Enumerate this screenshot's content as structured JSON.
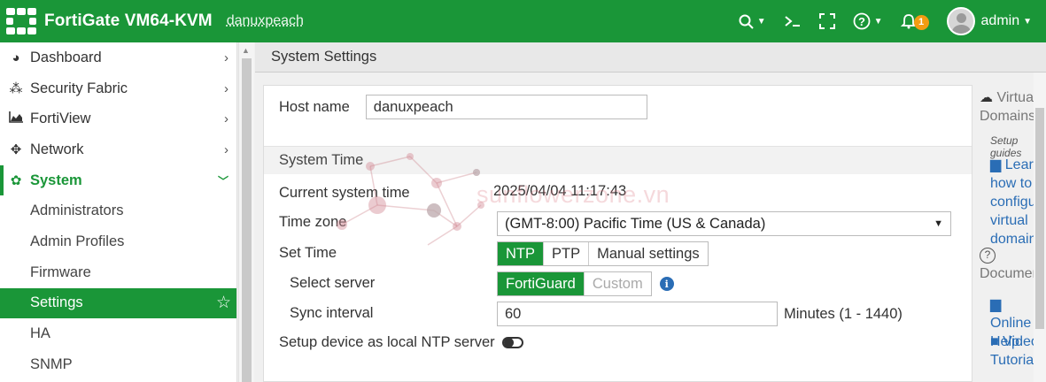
{
  "header": {
    "app_title": "FortiGate VM64-KVM",
    "hostname": "danuxpeach",
    "help_label": "?",
    "notif_count": "1",
    "user": "admin"
  },
  "sidebar": {
    "items": [
      {
        "label": "Dashboard",
        "icon": "dashboard-icon"
      },
      {
        "label": "Security Fabric",
        "icon": "security-fabric-icon"
      },
      {
        "label": "FortiView",
        "icon": "fortiview-icon"
      },
      {
        "label": "Network",
        "icon": "network-icon"
      },
      {
        "label": "System",
        "icon": "gear-icon"
      }
    ],
    "system_sub": [
      {
        "label": "Administrators"
      },
      {
        "label": "Admin Profiles"
      },
      {
        "label": "Firmware"
      },
      {
        "label": "Settings"
      },
      {
        "label": "HA"
      },
      {
        "label": "SNMP"
      }
    ]
  },
  "page": {
    "title": "System Settings"
  },
  "form": {
    "host_name_label": "Host name",
    "host_name_value": "danuxpeach",
    "system_time_section": "System Time",
    "current_time_label": "Current system time",
    "current_time_value": "2025/04/04 11:17:43",
    "timezone_label": "Time zone",
    "timezone_value": "(GMT-8:00) Pacific Time (US & Canada)",
    "set_time_label": "Set Time",
    "set_time_options": [
      "NTP",
      "PTP",
      "Manual settings"
    ],
    "set_time_selected": "NTP",
    "select_server_label": "Select server",
    "server_options": [
      "FortiGuard",
      "Custom"
    ],
    "server_selected": "FortiGuard",
    "sync_interval_label": "Sync interval",
    "sync_interval_value": "60",
    "sync_interval_unit": "Minutes (1 - 1440)",
    "ntp_server_label": "Setup device as local NTP server",
    "ntp_server_enabled": false
  },
  "watermark": {
    "text": "sunflowerzone.vn"
  },
  "help_panel": {
    "virtual_domains": "Virtual Domains",
    "setup_guides": "Setup guides",
    "learn_link": "Learn how to configure virtual domains",
    "documentation": "Documentation",
    "online_help": "Online Help",
    "video_tutorials": "Video Tutorials"
  },
  "colors": {
    "brand_green": "#1a9638",
    "link_blue": "#2a6db5",
    "badge_orange": "#f39c12"
  }
}
